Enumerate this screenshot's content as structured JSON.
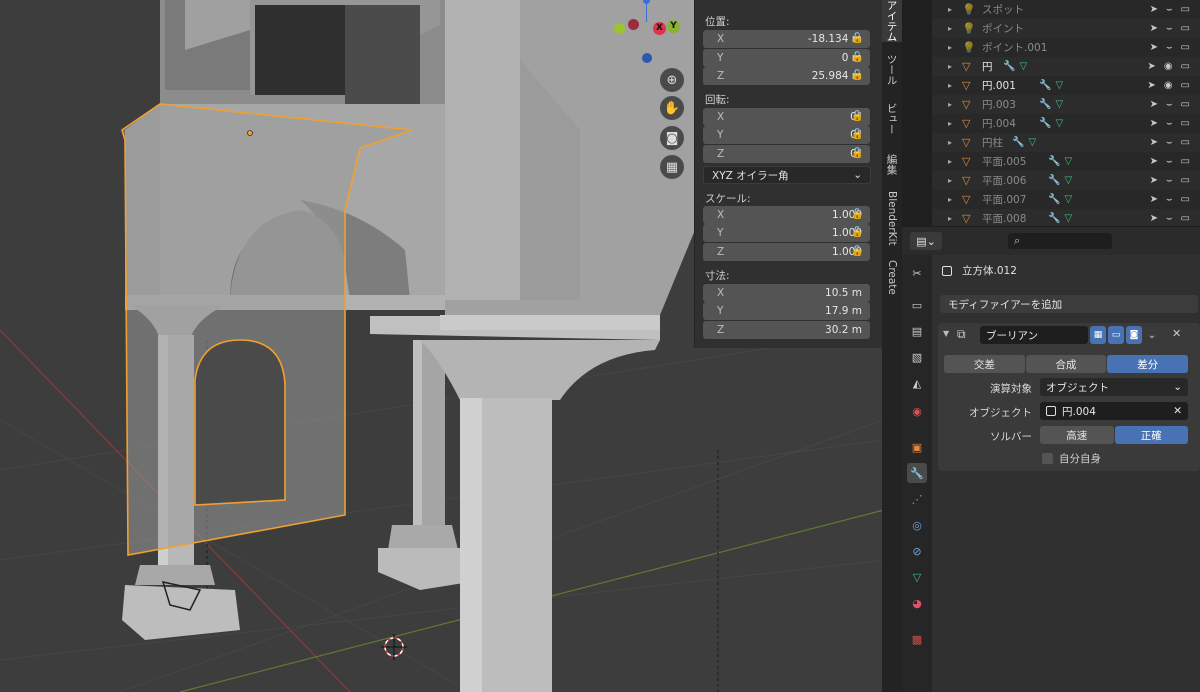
{
  "npanel": {
    "location_header": "位置:",
    "location": [
      {
        "axis": "X",
        "value": "-18.134 m"
      },
      {
        "axis": "Y",
        "value": "0 m"
      },
      {
        "axis": "Z",
        "value": "25.984 m"
      }
    ],
    "rotation_header": "回転:",
    "rotation": [
      {
        "axis": "X",
        "value": "0°"
      },
      {
        "axis": "Y",
        "value": "0°"
      },
      {
        "axis": "Z",
        "value": "0°"
      }
    ],
    "rotation_mode": "XYZ オイラー角",
    "scale_header": "スケール:",
    "scale": [
      {
        "axis": "X",
        "value": "1.000"
      },
      {
        "axis": "Y",
        "value": "1.000"
      },
      {
        "axis": "Z",
        "value": "1.000"
      }
    ],
    "dimensions_header": "寸法:",
    "dimensions": [
      {
        "axis": "X",
        "value": "10.5 m"
      },
      {
        "axis": "Y",
        "value": "17.9 m"
      },
      {
        "axis": "Z",
        "value": "30.2 m"
      }
    ]
  },
  "gizmo": {
    "x_label": "X",
    "y_label": "Y"
  },
  "tabs": [
    "アイテム",
    "ツール",
    "ビュー",
    "編集",
    "BlenderKit",
    "Create"
  ],
  "outliner": {
    "rows": [
      {
        "name": "スポット",
        "dim": true,
        "type": "light"
      },
      {
        "name": "ポイント",
        "dim": true,
        "type": "light"
      },
      {
        "name": "ポイント.001",
        "dim": true,
        "type": "light"
      },
      {
        "name": "円",
        "dim": false,
        "type": "mesh"
      },
      {
        "name": "円.001",
        "dim": false,
        "type": "mesh"
      },
      {
        "name": "円.003",
        "dim": true,
        "type": "mesh"
      },
      {
        "name": "円.004",
        "dim": true,
        "type": "mesh"
      },
      {
        "name": "円柱",
        "dim": true,
        "type": "mesh"
      },
      {
        "name": "平面.005",
        "dim": true,
        "type": "mesh"
      },
      {
        "name": "平面.006",
        "dim": true,
        "type": "mesh"
      },
      {
        "name": "平面.007",
        "dim": true,
        "type": "mesh"
      },
      {
        "name": "平面.008",
        "dim": true,
        "type": "mesh"
      }
    ]
  },
  "properties": {
    "object_name": "立方体.012",
    "add_modifier": "モディファイアーを追加",
    "modifier_name": "ブーリアン",
    "ops": [
      "交差",
      "合成",
      "差分"
    ],
    "active_op": "差分",
    "operand_label": "演算対象",
    "operand_value": "オブジェクト",
    "object_label": "オブジェクト",
    "object_value": "円.004",
    "solver_label": "ソルバー",
    "solver_fast": "高速",
    "solver_exact": "正確",
    "self_label": "自分自身"
  },
  "colors": {
    "selection": "#f0a030",
    "accent": "#4772b3",
    "mesh_icon": "#e08b3c",
    "modifier_icon": "#6fa8dc"
  }
}
